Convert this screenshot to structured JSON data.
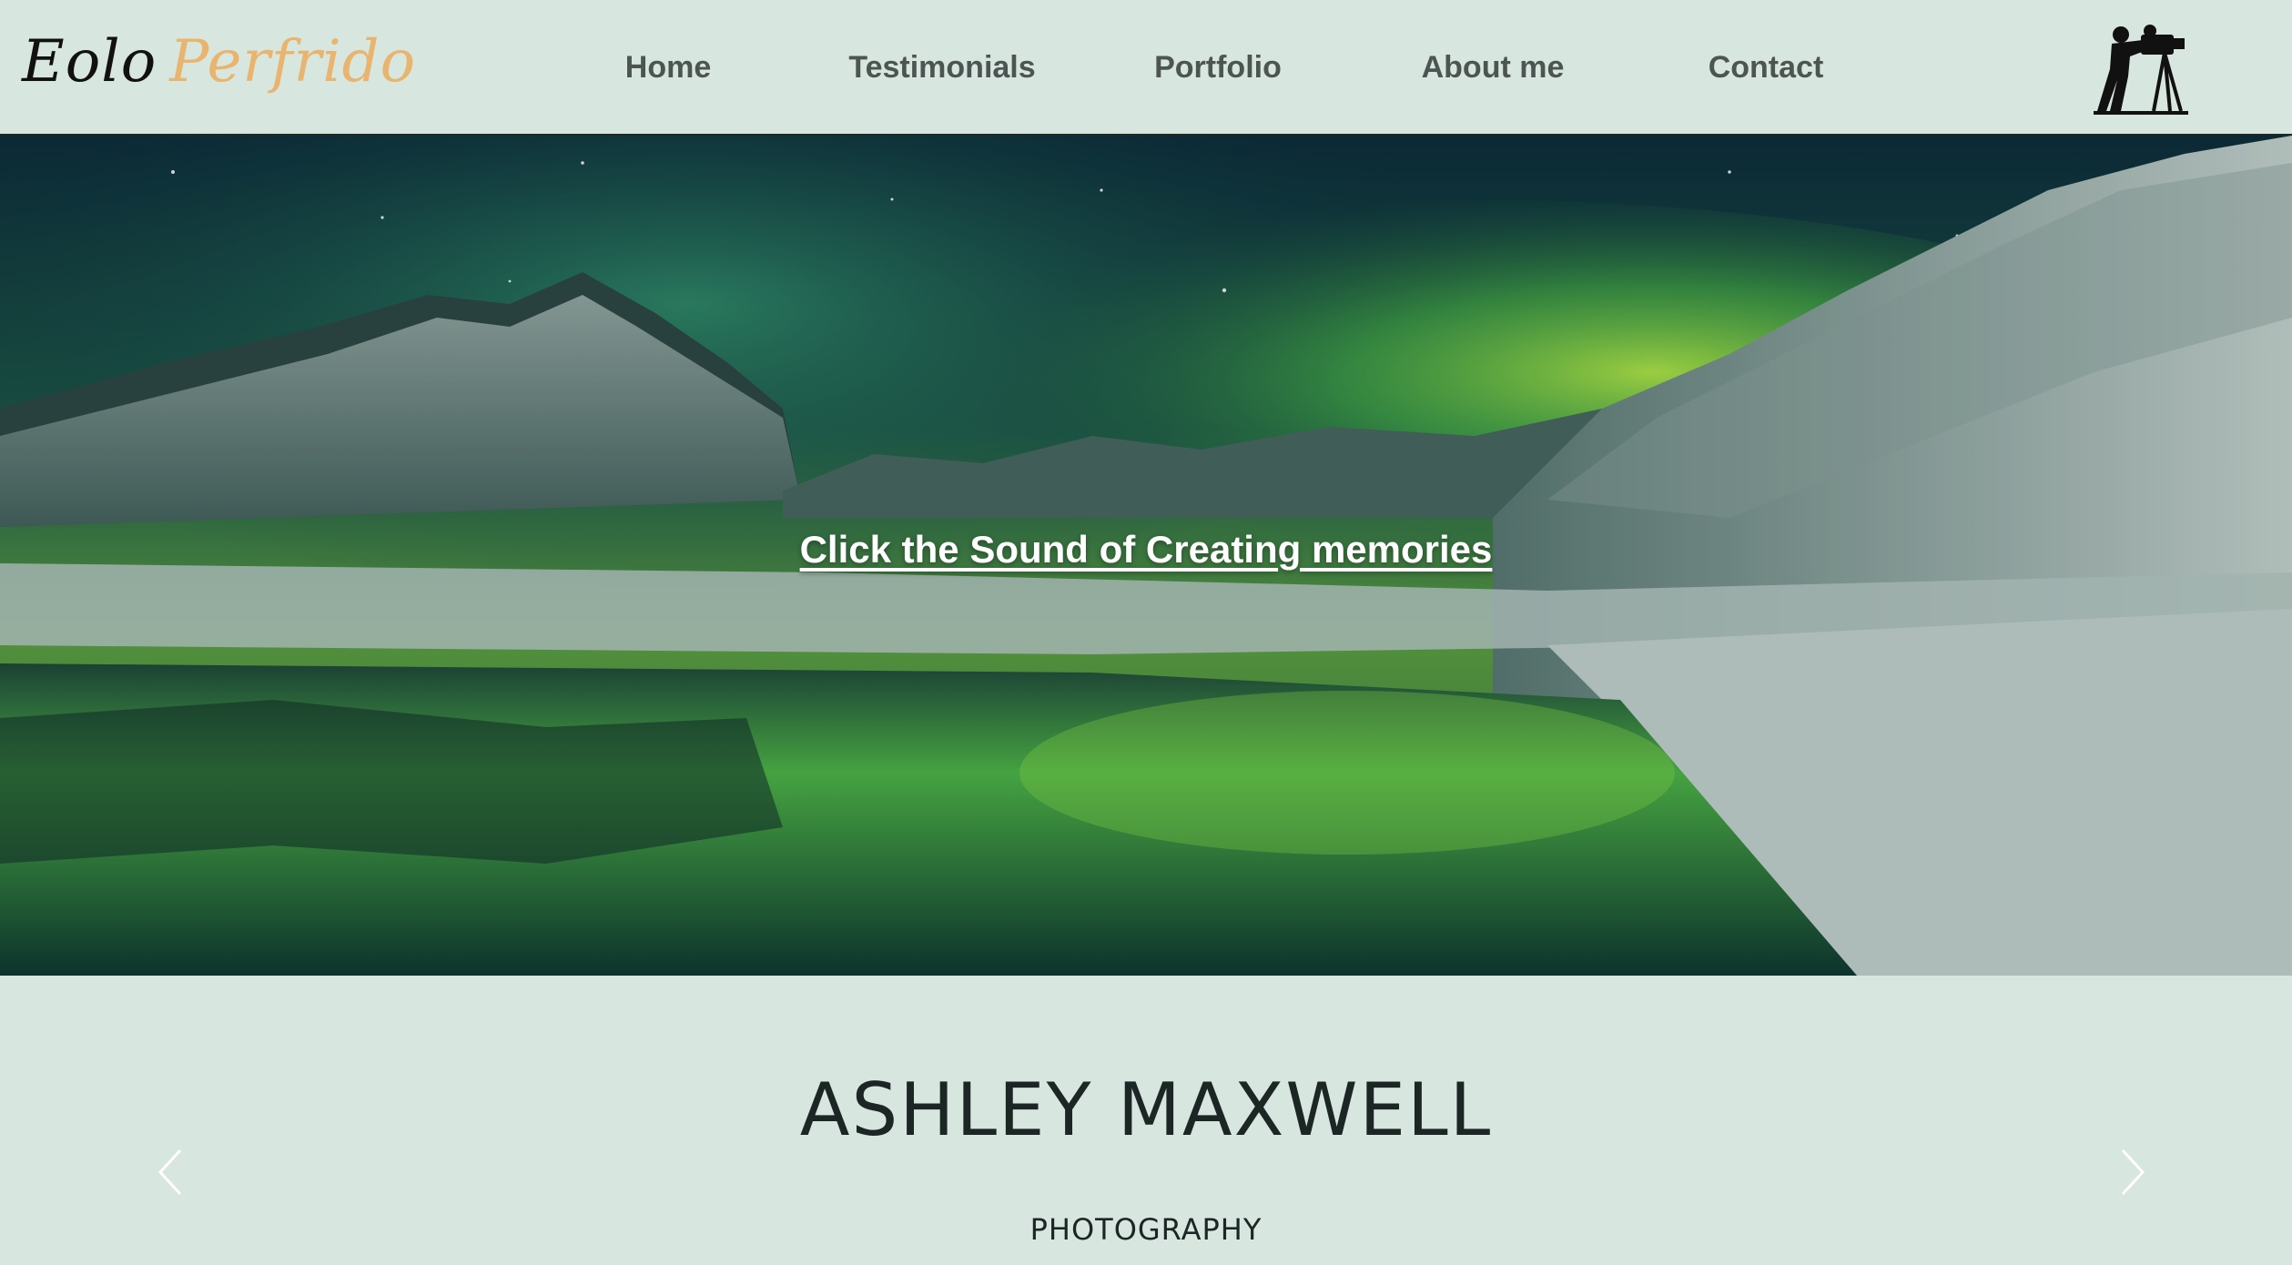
{
  "logo": {
    "part1": "Eolo",
    "part2": "Perfrido",
    "accent_color": "#e9b56e"
  },
  "nav": {
    "items": [
      {
        "label": "Home"
      },
      {
        "label": "Testimonials"
      },
      {
        "label": "Portfolio"
      },
      {
        "label": "About me"
      },
      {
        "label": "Contact"
      }
    ]
  },
  "header_icon": "camera-operator-silhouette-icon",
  "hero": {
    "link_text": "Click the Sound of Creating memories",
    "image": "aurora-borealis-over-snowy-mountains-and-lake"
  },
  "profile": {
    "name": "ASHLEY MAXWELL",
    "subtitle": "PHOTOGRAPHY"
  },
  "carousel": {
    "prev_icon": "chevron-left-icon",
    "next_icon": "chevron-right-icon"
  },
  "colors": {
    "background": "#d7e6df",
    "nav_text": "#4d5552",
    "heading": "#1c2624"
  }
}
